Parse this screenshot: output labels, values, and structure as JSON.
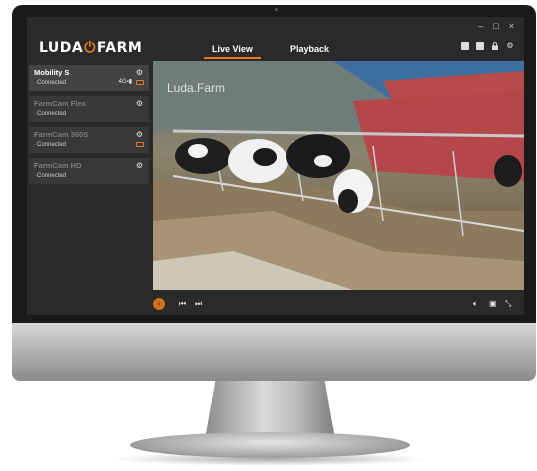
{
  "app": {
    "logo_left": "LUDA",
    "logo_right": "FARM"
  },
  "window": {
    "minimize": "–",
    "maximize": "□",
    "close": "×"
  },
  "nav": {
    "tabs": [
      "Live View",
      "Playback"
    ],
    "active": 0
  },
  "cameras": [
    {
      "name": "Mobility S",
      "status": "Connected",
      "signal": "4G",
      "selected": true
    },
    {
      "name": "FarmCam Flex",
      "status": "Connected",
      "selected": false
    },
    {
      "name": "FarmCam 360S",
      "status": "Connected",
      "selected": false
    },
    {
      "name": "FarmCam HD",
      "status": "Connected",
      "selected": false
    }
  ],
  "video": {
    "watermark": "Luda.Farm"
  },
  "colors": {
    "accent": "#e87a1b",
    "screen": "#2a2a2a"
  },
  "icons": {
    "top_bar": [
      "grid-icon",
      "plus-icon",
      "lock-icon",
      "gear-icon"
    ],
    "controls": [
      "back-icon",
      "prev-icon",
      "next-icon",
      "volume-icon",
      "fullscreen-icon",
      "expand-icon"
    ]
  }
}
